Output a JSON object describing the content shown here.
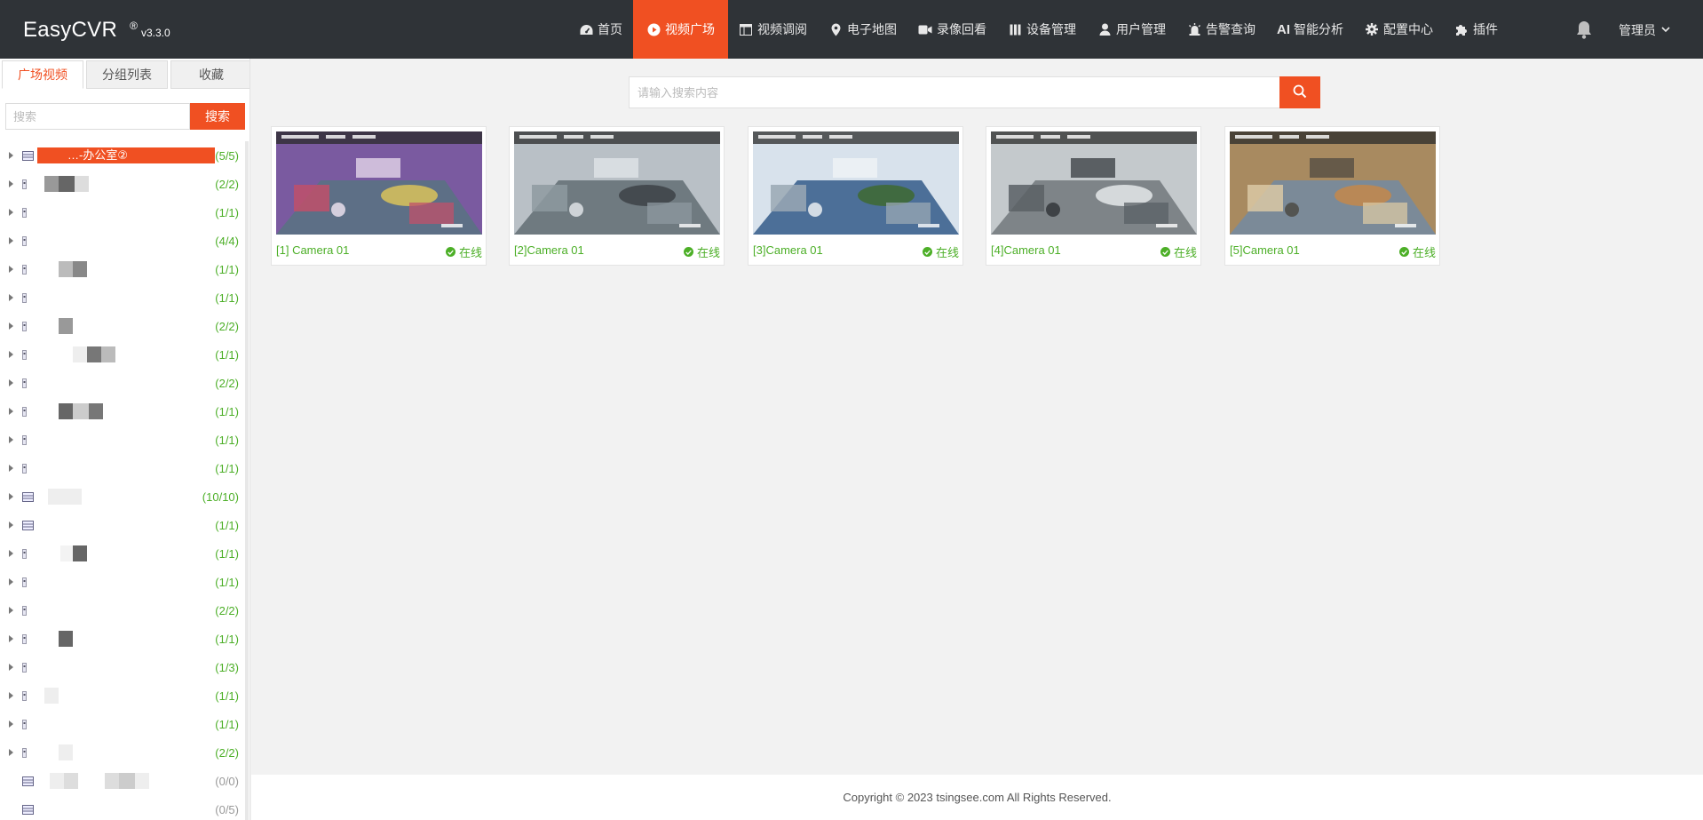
{
  "app": {
    "name": "EasyCVR",
    "reg": "®",
    "version": "v3.3.0"
  },
  "nav": [
    {
      "label": "首页",
      "icon": "dashboard-icon"
    },
    {
      "label": "视频广场",
      "icon": "play-circle-icon",
      "active": true
    },
    {
      "label": "视频调阅",
      "icon": "grid-layout-icon"
    },
    {
      "label": "电子地图",
      "icon": "map-pin-icon"
    },
    {
      "label": "录像回看",
      "icon": "video-camera-icon"
    },
    {
      "label": "设备管理",
      "icon": "device-icon"
    },
    {
      "label": "用户管理",
      "icon": "user-icon"
    },
    {
      "label": "告警查询",
      "icon": "alarm-icon"
    },
    {
      "label": "智能分析",
      "icon": "ai-icon"
    },
    {
      "label": "配置中心",
      "icon": "gear-icon"
    },
    {
      "label": "插件",
      "icon": "puzzle-icon"
    }
  ],
  "header": {
    "user_label": "管理员",
    "bell_icon": "bell-icon"
  },
  "sidebar": {
    "tabs": [
      {
        "label": "广场视频",
        "active": true
      },
      {
        "label": "分组列表"
      },
      {
        "label": "收藏"
      }
    ],
    "search_placeholder": "搜索",
    "search_button": "搜索",
    "tree": [
      {
        "label": "…-办公室②",
        "count": "(5/5)",
        "selected": true,
        "icon": "server-icon"
      },
      {
        "label": "",
        "count": "(2/2)",
        "icon": "camera-node-icon"
      },
      {
        "label": "",
        "count": "(1/1)",
        "icon": "camera-node-icon"
      },
      {
        "label": "",
        "count": "(4/4)",
        "icon": "camera-node-icon"
      },
      {
        "label": "",
        "count": "(1/1)",
        "icon": "camera-node-icon"
      },
      {
        "label": "",
        "count": "(1/1)",
        "icon": "camera-node-icon"
      },
      {
        "label": "",
        "count": "(2/2)",
        "icon": "camera-node-icon"
      },
      {
        "label": "",
        "count": "(1/1)",
        "icon": "camera-node-icon"
      },
      {
        "label": "",
        "count": "(2/2)",
        "icon": "camera-node-icon"
      },
      {
        "label": "",
        "count": "(1/1)",
        "icon": "camera-node-icon"
      },
      {
        "label": "",
        "count": "(1/1)",
        "icon": "camera-node-icon"
      },
      {
        "label": "",
        "count": "(1/1)",
        "icon": "camera-node-icon"
      },
      {
        "label": "",
        "count": "(10/10)",
        "icon": "server-icon"
      },
      {
        "label": "",
        "count": "(1/1)",
        "icon": "server-icon"
      },
      {
        "label": "",
        "count": "(1/1)",
        "icon": "camera-node-icon"
      },
      {
        "label": "",
        "count": "(1/1)",
        "icon": "camera-node-icon"
      },
      {
        "label": "",
        "count": "(2/2)",
        "icon": "camera-node-icon"
      },
      {
        "label": "",
        "count": "(1/1)",
        "icon": "camera-node-icon"
      },
      {
        "label": "",
        "count": "(1/3)",
        "icon": "camera-node-icon"
      },
      {
        "label": "",
        "count": "(1/1)",
        "icon": "camera-node-icon"
      },
      {
        "label": "",
        "count": "(1/1)",
        "icon": "camera-node-icon"
      },
      {
        "label": "",
        "count": "(2/2)",
        "icon": "camera-node-icon"
      },
      {
        "label": "",
        "count": "(0/0)",
        "icon": "server-icon",
        "zero": true
      },
      {
        "label": "",
        "count": "(0/5)",
        "icon": "server-icon",
        "zero": true
      }
    ]
  },
  "main": {
    "search_placeholder": "请输入搜索内容",
    "search_icon": "search-icon",
    "cameras": [
      {
        "title": "[1] Camera 01",
        "status": "在线"
      },
      {
        "title": "[2]Camera 01",
        "status": "在线"
      },
      {
        "title": "[3]Camera 01",
        "status": "在线"
      },
      {
        "title": "[4]Camera 01",
        "status": "在线"
      },
      {
        "title": "[5]Camera 01",
        "status": "在线"
      }
    ]
  },
  "footer": {
    "copyright": "Copyright © 2023 tsingsee.com All Rights Reserved."
  },
  "colors": {
    "accent": "#f05022",
    "header_bg": "#2f3337",
    "online": "#4caf27"
  }
}
